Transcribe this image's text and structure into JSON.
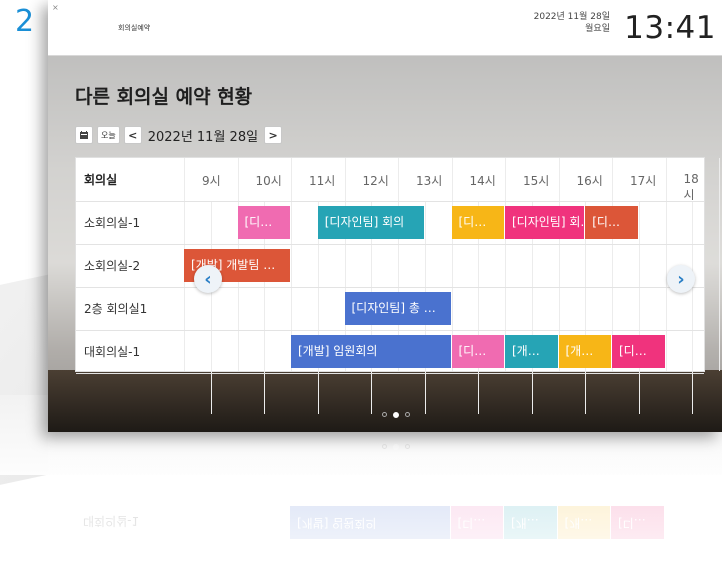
{
  "slide_number": "2",
  "header": {
    "close_mark": "×",
    "brand": "회의실예약",
    "date": "2022년 11월 28일",
    "weekday": "월요일",
    "time": "13:41"
  },
  "title": "다른 회의실 예약 현황",
  "nav": {
    "calendar_icon": "calendar-icon",
    "today_label": "오늘",
    "prev_label": "<",
    "date": "2022년 11월 28일",
    "next_label": ">"
  },
  "grid": {
    "room_header": "회의실",
    "hours": [
      "9시",
      "10시",
      "11시",
      "12시",
      "13시",
      "14시",
      "15시",
      "16시",
      "17시",
      "18시"
    ],
    "rooms": [
      "소회의실-1",
      "소회의실-2",
      "2층 회의실1",
      "대회의실-1"
    ],
    "events": [
      {
        "room": 0,
        "start": 10,
        "end": 11,
        "label": "[디…",
        "color": "#f06bb1"
      },
      {
        "room": 0,
        "start": 11.5,
        "end": 13.5,
        "label": "[디자인팀] 회의",
        "color": "#26a4b5"
      },
      {
        "room": 0,
        "start": 14,
        "end": 15,
        "label": "[디…",
        "color": "#f7b617"
      },
      {
        "room": 0,
        "start": 15,
        "end": 16.5,
        "label": "[디자인팀] 회…",
        "color": "#f0337d"
      },
      {
        "room": 0,
        "start": 16.5,
        "end": 17.5,
        "label": "[디…",
        "color": "#dc5638"
      },
      {
        "room": 1,
        "start": 9,
        "end": 11,
        "label": "[개발] 개발팀 …",
        "color": "#dc5638"
      },
      {
        "room": 2,
        "start": 12,
        "end": 14,
        "label": "[디자인팀] 총 …",
        "color": "#4a72cf"
      },
      {
        "room": 3,
        "start": 11,
        "end": 14,
        "label": "[개발] 임원회의",
        "color": "#4a72cf"
      },
      {
        "room": 3,
        "start": 14,
        "end": 15,
        "label": "[디…",
        "color": "#f06bb1"
      },
      {
        "room": 3,
        "start": 15,
        "end": 16,
        "label": "[개…",
        "color": "#26a4b5"
      },
      {
        "room": 3,
        "start": 16,
        "end": 17,
        "label": "[개…",
        "color": "#f7b617"
      },
      {
        "room": 3,
        "start": 17,
        "end": 18,
        "label": "[디…",
        "color": "#f0337d"
      }
    ]
  },
  "controls": {
    "prev_icon": "chevron-left-icon",
    "next_icon": "chevron-right-icon",
    "prev_symbol": "‹",
    "next_symbol": "›"
  },
  "pagination": {
    "count": 3,
    "active": 1
  }
}
